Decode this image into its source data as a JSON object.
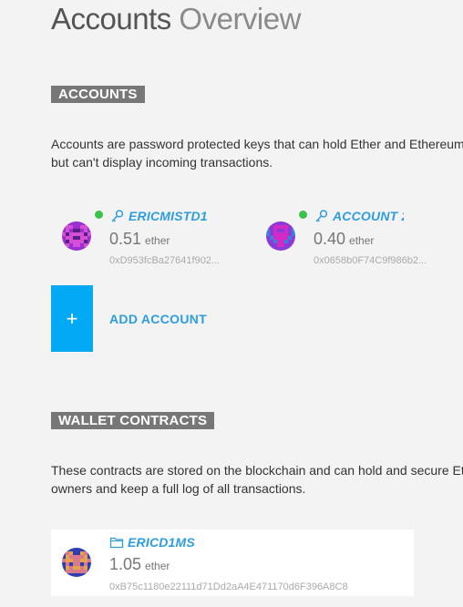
{
  "header": {
    "title_main": "Accounts",
    "title_sub": "Overview"
  },
  "accounts_section": {
    "tag": "ACCOUNTS",
    "description_line1": "Accounts are password protected keys that can hold Ether and Ethereum",
    "description_line2": "but can't display incoming transactions.",
    "accounts": [
      {
        "name": "ERICMISTD1",
        "balance": "0.51",
        "unit": "ether",
        "address": "0xD953fcBa27641f902..."
      },
      {
        "name": "ACCOUNT 2",
        "balance": "0.40",
        "unit": "ether",
        "address": "0x0658b0F74C9f986b2..."
      }
    ],
    "add_button_icon": "+",
    "add_label": "ADD ACCOUNT"
  },
  "wallets_section": {
    "tag": "WALLET CONTRACTS",
    "description_line1": "These contracts are stored on the blockchain and can hold and secure Ether",
    "description_line2": "owners and keep a full log of all transactions.",
    "wallets": [
      {
        "name": "ERICD1MS",
        "balance": "1.05",
        "unit": "ether",
        "address": "0xB75c1180e22111d71Dd2aA4E471170d6F396A8C8"
      }
    ]
  },
  "colors": {
    "accent": "#2e9de0",
    "add_button": "#03a9f4",
    "section_tag": "#777777",
    "status_online": "#3ac24a"
  },
  "icons": {
    "key": "key-icon",
    "wallet": "folder-icon",
    "status": "online-status-dot"
  }
}
